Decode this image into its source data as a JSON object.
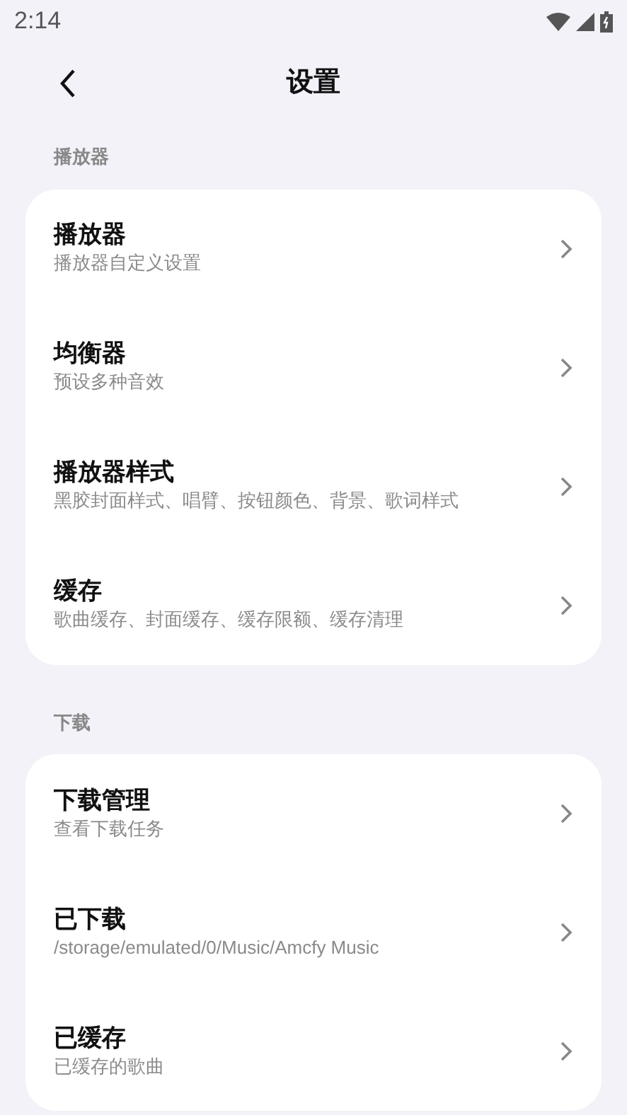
{
  "status_bar": {
    "time": "2:14"
  },
  "header": {
    "title": "设置"
  },
  "sections": [
    {
      "label": "播放器",
      "items": [
        {
          "title": "播放器",
          "subtitle": "播放器自定义设置"
        },
        {
          "title": "均衡器",
          "subtitle": "预设多种音效"
        },
        {
          "title": "播放器样式",
          "subtitle": "黑胶封面样式、唱臂、按钮颜色、背景、歌词样式"
        },
        {
          "title": "缓存",
          "subtitle": "歌曲缓存、封面缓存、缓存限额、缓存清理"
        }
      ]
    },
    {
      "label": "下载",
      "items": [
        {
          "title": "下载管理",
          "subtitle": "查看下载任务"
        },
        {
          "title": "已下载",
          "subtitle": "/storage/emulated/0/Music/Amcfy Music"
        },
        {
          "title": "已缓存",
          "subtitle": "已缓存的歌曲"
        }
      ]
    }
  ]
}
